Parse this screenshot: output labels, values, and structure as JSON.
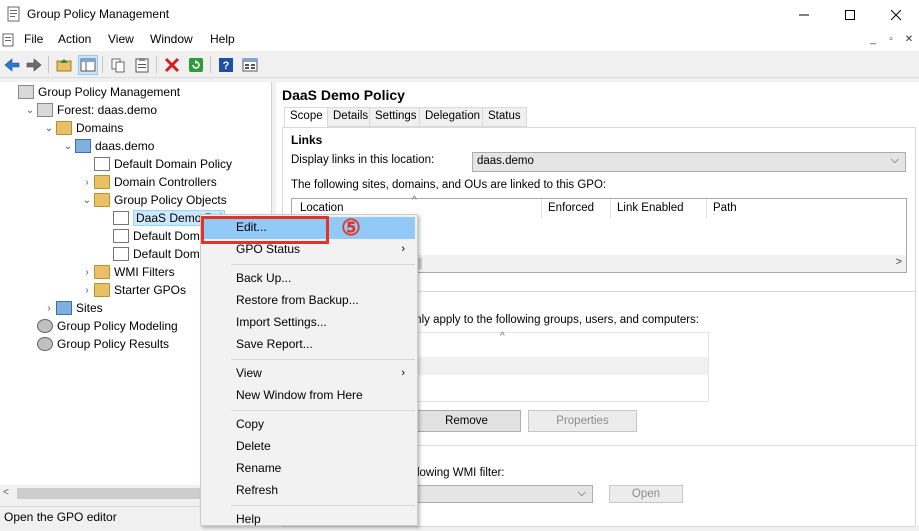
{
  "window": {
    "title": "Group Policy Management",
    "controls": [
      "minimize-icon",
      "maximize-icon",
      "close-icon"
    ]
  },
  "menubar": {
    "items": [
      "File",
      "Action",
      "View",
      "Window",
      "Help"
    ]
  },
  "toolbar": {
    "icons": [
      "back-arrow-icon",
      "forward-arrow-icon",
      "up-folder-icon",
      "show-hide-tree-icon",
      "copy-icon",
      "paste-icon",
      "delete-icon",
      "refresh-icon",
      "help-icon",
      "properties-icon"
    ]
  },
  "tree": {
    "items": [
      {
        "label": "Group Policy Management",
        "indent": 0,
        "chev": "",
        "icon": "gpm-icon"
      },
      {
        "label": "Forest: daas.demo",
        "indent": 1,
        "chev": "v",
        "icon": "forest-icon"
      },
      {
        "label": "Domains",
        "indent": 2,
        "chev": "v",
        "icon": "folder-icon"
      },
      {
        "label": "daas.demo",
        "indent": 3,
        "chev": "v",
        "icon": "domain-icon"
      },
      {
        "label": "Default Domain Policy",
        "indent": 4,
        "chev": "",
        "icon": "gpo-link-icon"
      },
      {
        "label": "Domain Controllers",
        "indent": 4,
        "chev": ">",
        "icon": "ou-folder-icon"
      },
      {
        "label": "Group Policy Objects",
        "indent": 4,
        "chev": "v",
        "icon": "folder-icon"
      },
      {
        "label": "DaaS Demo Pol",
        "indent": 5,
        "chev": "",
        "icon": "gpo-icon",
        "selected": true
      },
      {
        "label": "Default Domain",
        "indent": 5,
        "chev": "",
        "icon": "gpo-icon"
      },
      {
        "label": "Default Domain",
        "indent": 5,
        "chev": "",
        "icon": "gpo-icon"
      },
      {
        "label": "WMI Filters",
        "indent": 4,
        "chev": ">",
        "icon": "folder-icon"
      },
      {
        "label": "Starter GPOs",
        "indent": 4,
        "chev": ">",
        "icon": "folder-icon"
      },
      {
        "label": "Sites",
        "indent": 2,
        "chev": ">",
        "icon": "sites-icon"
      },
      {
        "label": "Group Policy Modeling",
        "indent": 1,
        "chev": "",
        "icon": "modeling-icon"
      },
      {
        "label": "Group Policy Results",
        "indent": 1,
        "chev": "",
        "icon": "results-icon"
      }
    ]
  },
  "right": {
    "title": "DaaS Demo Policy",
    "tabs": [
      "Scope",
      "Details",
      "Settings",
      "Delegation",
      "Status"
    ],
    "active_tab": "Scope",
    "links_heading": "Links",
    "display_links_label": "Display links in this location:",
    "location_value": "daas.demo",
    "linked_text": "The following sites, domains, and OUs are linked to this GPO:",
    "columns": [
      "Location",
      "Enforced",
      "Link Enabled",
      "Path"
    ],
    "security_text_partial": "n only apply to the following groups, users, and computers:",
    "remove_button": "Remove",
    "properties_button": "Properties",
    "wmi_text_partial": "ollowing WMI filter:",
    "open_button": "Open"
  },
  "context_menu": {
    "items": [
      {
        "label": "Edit...",
        "highlighted": true
      },
      {
        "label": "GPO Status",
        "submenu": true
      },
      {
        "sep": true
      },
      {
        "label": "Back Up..."
      },
      {
        "label": "Restore from Backup..."
      },
      {
        "label": "Import Settings..."
      },
      {
        "label": "Save Report..."
      },
      {
        "sep": true
      },
      {
        "label": "View",
        "submenu": true
      },
      {
        "label": "New Window from Here"
      },
      {
        "sep": true
      },
      {
        "label": "Copy"
      },
      {
        "label": "Delete"
      },
      {
        "label": "Rename"
      },
      {
        "label": "Refresh"
      },
      {
        "sep": true
      },
      {
        "label": "Help"
      }
    ]
  },
  "annotation": {
    "step": "⑤",
    "color": "#e53222"
  },
  "status_bar": {
    "text": "Open the GPO editor"
  }
}
